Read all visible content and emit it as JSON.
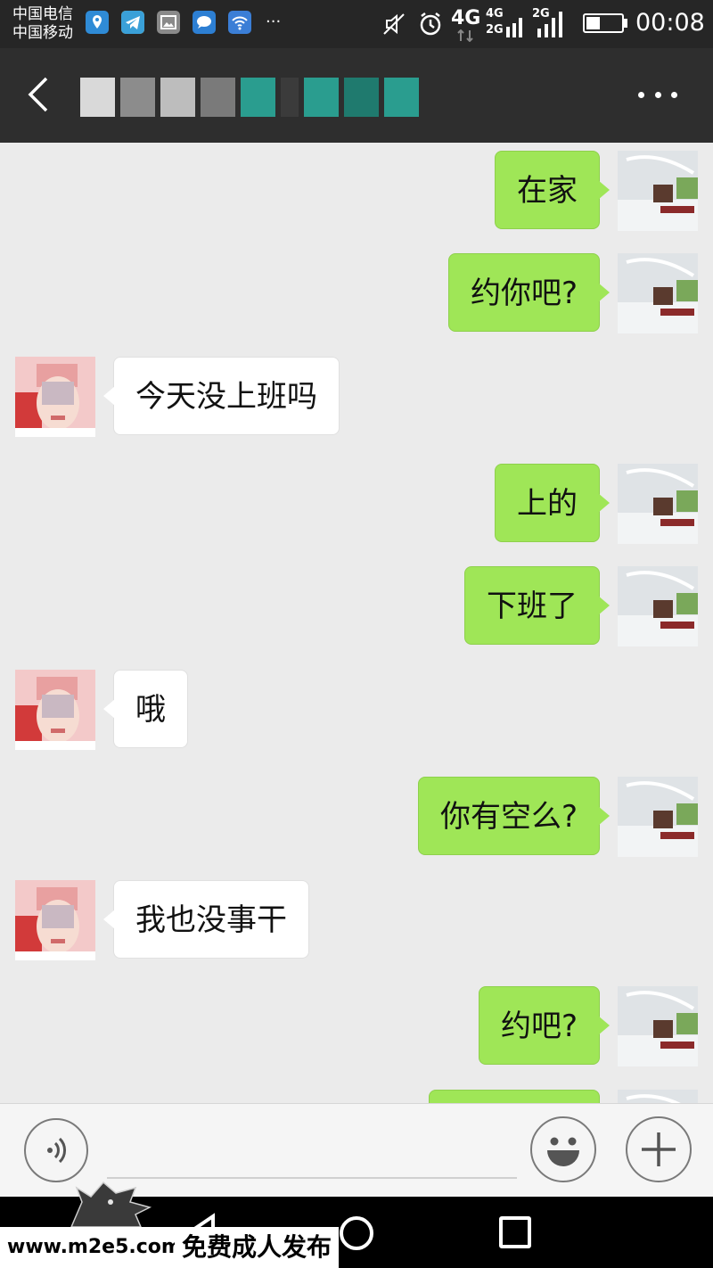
{
  "status_bar": {
    "carrier_1": "中国电信",
    "carrier_2": "中国移动",
    "more_notifications": "···",
    "network_main": "4G",
    "network_dual_top": "4G",
    "network_dual_bottom": "2G",
    "network_sim2": "2G",
    "time": "00:08",
    "battery_level": 0.4
  },
  "title_bar": {
    "contact_name_obscured": ""
  },
  "messages": [
    {
      "side": "right",
      "text": "在家"
    },
    {
      "side": "right",
      "text": "约你吧?"
    },
    {
      "side": "left",
      "text": "今天没上班吗"
    },
    {
      "side": "right",
      "text": "上的"
    },
    {
      "side": "right",
      "text": "下班了"
    },
    {
      "side": "left",
      "text": "哦"
    },
    {
      "side": "right",
      "text": "你有空么?"
    },
    {
      "side": "left",
      "text": "我也没事干"
    },
    {
      "side": "right",
      "text": "约吧?"
    },
    {
      "side": "right",
      "text": ""
    }
  ],
  "watermark": {
    "url": "www.m2e5.com",
    "text": "免费成人发布"
  }
}
